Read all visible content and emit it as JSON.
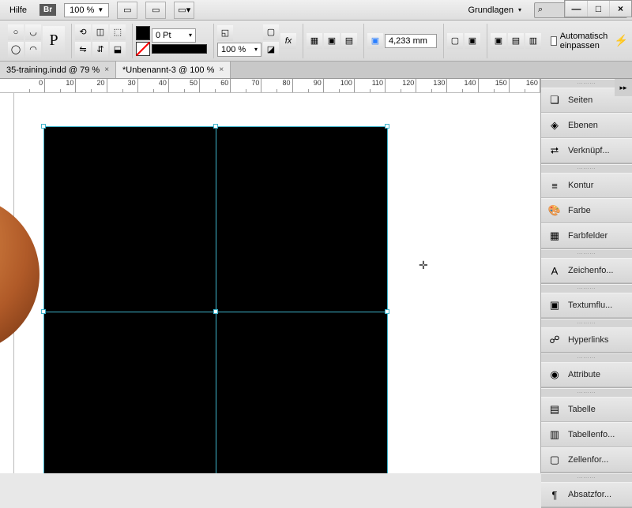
{
  "menubar": {
    "help": "Hilfe",
    "bridge_badge": "Br",
    "zoom": "100 %",
    "workspace": "Grundlagen"
  },
  "toolbar": {
    "stroke_weight": "0 Pt",
    "opacity": "100 %",
    "width_field": "4,233 mm",
    "auto_fit": "Automatisch einpassen"
  },
  "tabs": [
    {
      "label": "35-training.indd @ 79 %",
      "active": false
    },
    {
      "label": "*Unbenannt-3 @ 100 %",
      "active": true
    }
  ],
  "ruler_ticks": [
    "0",
    "10",
    "20",
    "30",
    "40",
    "50",
    "60",
    "70",
    "80",
    "90",
    "100",
    "110",
    "120",
    "130",
    "140",
    "150",
    "160"
  ],
  "panels": {
    "g1": [
      "Seiten",
      "Ebenen",
      "Verknüpf..."
    ],
    "g2": [
      "Kontur",
      "Farbe",
      "Farbfelder"
    ],
    "g3": [
      "Zeichenfo..."
    ],
    "g4": [
      "Textumflu..."
    ],
    "g5": [
      "Hyperlinks"
    ],
    "g6": [
      "Attribute"
    ],
    "g7": [
      "Tabelle",
      "Tabellenfo...",
      "Zellenfor..."
    ],
    "g8": [
      "Absatzfor..."
    ]
  },
  "panel_icons": {
    "Seiten": "❏",
    "Ebenen": "◈",
    "Verknüpf...": "⮂",
    "Kontur": "≡",
    "Farbe": "🎨",
    "Farbfelder": "▦",
    "Zeichenfo...": "A",
    "Textumflu...": "▣",
    "Hyperlinks": "☍",
    "Attribute": "◉",
    "Tabelle": "▤",
    "Tabellenfo...": "▥",
    "Zellenfor...": "▢",
    "Absatzfor...": "¶"
  }
}
